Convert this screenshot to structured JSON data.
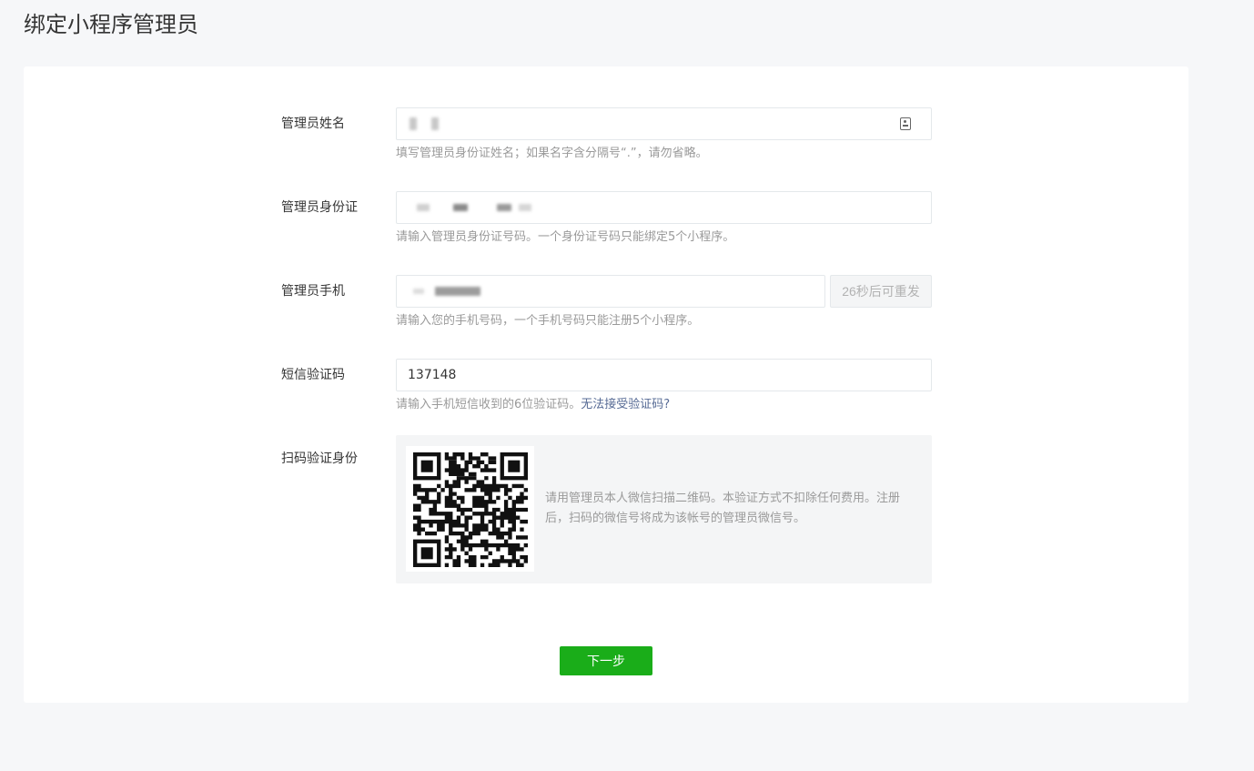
{
  "page": {
    "title": "绑定小程序管理员"
  },
  "form": {
    "name": {
      "label": "管理员姓名",
      "hint": "填写管理员身份证姓名；如果名字含分隔号“.”，请勿省略。",
      "icon": "id-card-icon"
    },
    "id_card": {
      "label": "管理员身份证",
      "hint": "请输入管理员身份证号码。一个身份证号码只能绑定5个小程序。"
    },
    "phone": {
      "label": "管理员手机",
      "hint": "请输入您的手机号码，一个手机号码只能注册5个小程序。",
      "resend_label": "26秒后可重发"
    },
    "sms": {
      "label": "短信验证码",
      "value": "137148",
      "hint": "请输入手机短信收到的6位验证码。",
      "hint_link": "无法接受验证码?"
    },
    "scan": {
      "label": "扫码验证身份",
      "text": "请用管理员本人微信扫描二维码。本验证方式不扣除任何费用。注册后，扫码的微信号将成为该帐号的管理员微信号。"
    }
  },
  "actions": {
    "next_label": "下一步"
  },
  "colors": {
    "primary": "#1aad19",
    "link": "#576b95",
    "hint": "#9a9a9a"
  }
}
